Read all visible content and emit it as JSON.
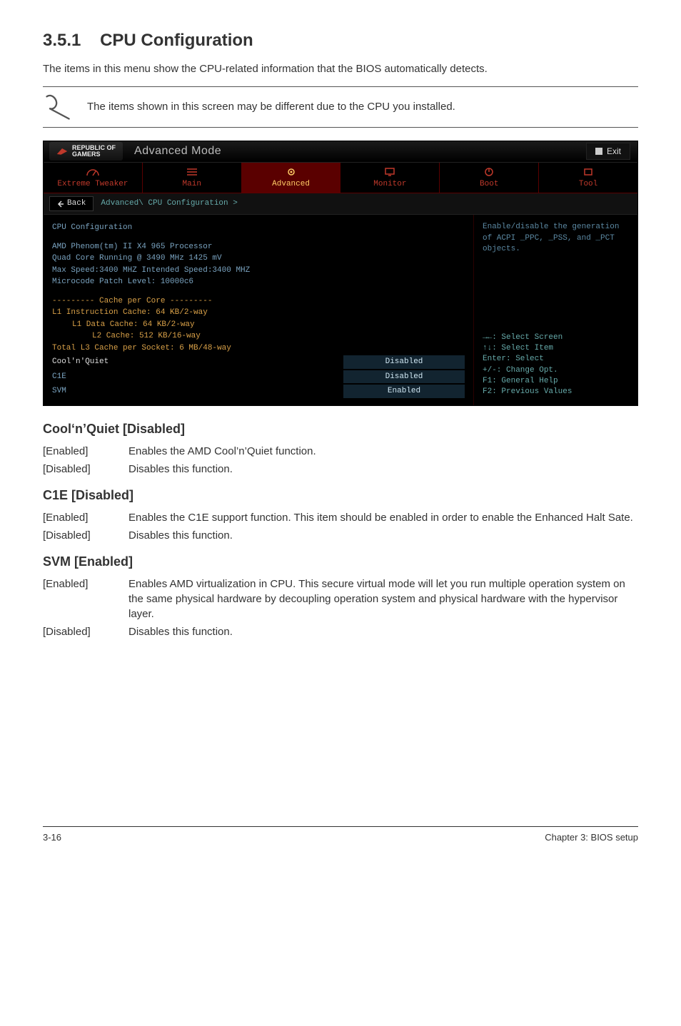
{
  "doc": {
    "section_num": "3.5.1",
    "section_title": "CPU Configuration",
    "intro": "The items in this menu show the CPU-related information that the BIOS automatically detects.",
    "note_text": "The items shown in this screen may be different due to the CPU you installed.",
    "subs": {
      "cool": {
        "title": "Cool‘n’Quiet [Disabled]",
        "rows": [
          {
            "k": "[Enabled]",
            "v": "Enables the AMD Cool’n’Quiet function."
          },
          {
            "k": "[Disabled]",
            "v": "Disables this function."
          }
        ]
      },
      "c1e": {
        "title": "C1E [Disabled]",
        "rows": [
          {
            "k": "[Enabled]",
            "v": "Enables the C1E support function. This item should be enabled in order to enable the Enhanced Halt Sate."
          },
          {
            "k": "[Disabled]",
            "v": "Disables this function."
          }
        ]
      },
      "svm": {
        "title": "SVM [Enabled]",
        "rows": [
          {
            "k": "[Enabled]",
            "v": "Enables AMD virtualization in CPU. This secure virtual mode will let you run multiple operation system on the same physical hardware by decoupling operation system and physical hardware with the hypervisor layer."
          },
          {
            "k": "[Disabled]",
            "v": "Disables this function."
          }
        ]
      }
    },
    "footer_left": "3-16",
    "footer_right": "Chapter 3: BIOS setup"
  },
  "bios": {
    "brand_line1": "REPUBLIC OF",
    "brand_line2": "GAMERS",
    "mode_title": "Advanced Mode",
    "exit_label": "Exit",
    "tabs": [
      {
        "name": "extreme-tweaker",
        "label": "Extreme Tweaker"
      },
      {
        "name": "main",
        "label": "Main"
      },
      {
        "name": "advanced",
        "label": "Advanced"
      },
      {
        "name": "monitor",
        "label": "Monitor"
      },
      {
        "name": "boot",
        "label": "Boot"
      },
      {
        "name": "tool",
        "label": "Tool"
      }
    ],
    "back_label": "Back",
    "breadcrumb": "Advanced\\ CPU Configuration >",
    "panel_title": "CPU Configuration",
    "info_lines": [
      "AMD Phenom(tm) II X4 965 Processor",
      "Quad Core Running @ 3490 MHz  1425 mV",
      "Max Speed:3400 MHZ     Intended Speed:3400 MHZ",
      "Microcode Patch Level: 10000c6"
    ],
    "cache_header": "--------- Cache per Core ---------",
    "cache_lines": [
      "L1 Instruction Cache: 64 KB/2-way",
      "L1 Data Cache: 64 KB/2-way",
      "L2 Cache: 512 KB/16-way",
      "Total L3 Cache per Socket: 6 MB/48-way"
    ],
    "settings": [
      {
        "label": "Cool'n'Quiet",
        "value": "Disabled"
      },
      {
        "label": "C1E",
        "value": "Disabled"
      },
      {
        "label": "SVM",
        "value": "Enabled"
      }
    ],
    "help_text": "Enable/disable the generation of ACPI _PPC, _PSS, and _PCT objects.",
    "nav_hints": [
      "→←: Select Screen",
      "↑↓: Select Item",
      "Enter: Select",
      "+/-: Change Opt.",
      "F1: General Help",
      "F2: Previous Values"
    ]
  }
}
